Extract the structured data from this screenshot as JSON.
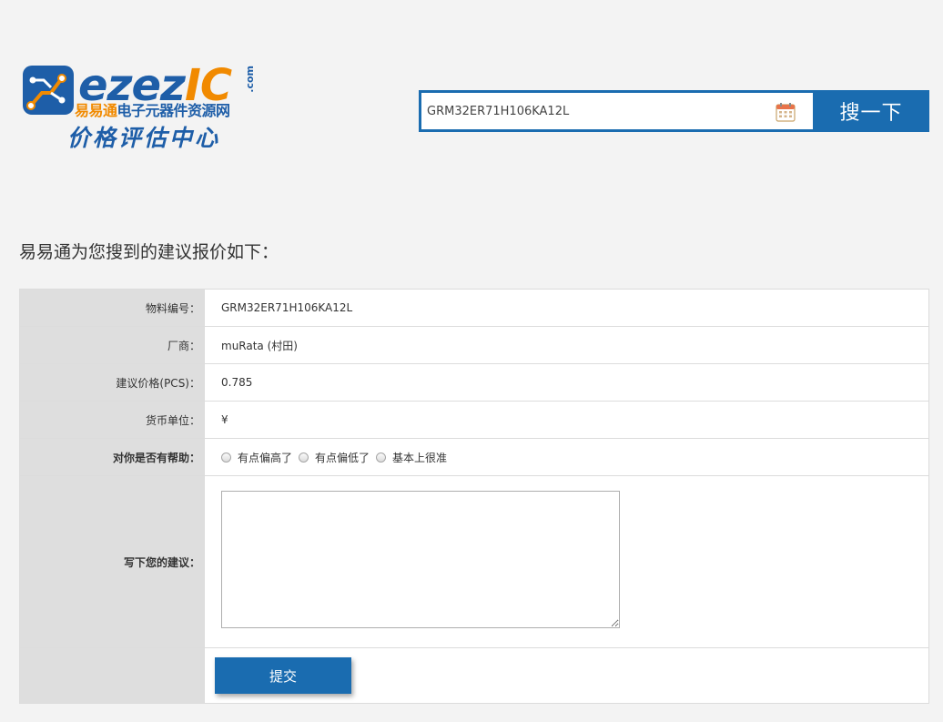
{
  "logo": {
    "brand_part1": "ezez",
    "brand_part2": "IC",
    "brand_domain": ".com",
    "tagline_part1": "易易通",
    "tagline_part2": "电子元器件资源网",
    "subtitle": "价格评估中心"
  },
  "search": {
    "value": "GRM32ER71H106KA12L",
    "button_label": "搜一下",
    "icon": "calendar-icon"
  },
  "intro_text": "易易通为您搜到的建议报价如下：",
  "table": {
    "part_number": {
      "label": "物料编号：",
      "value": "GRM32ER71H106KA12L"
    },
    "manufacturer": {
      "label": "厂商：",
      "value": "muRata (村田)"
    },
    "price": {
      "label": "建议价格(PCS)：",
      "value": "0.785"
    },
    "currency": {
      "label": "货币单位：",
      "value": "¥"
    },
    "helpful": {
      "label": "对你是否有帮助：",
      "options": [
        "有点偏高了",
        "有点偏低了",
        "基本上很准"
      ]
    },
    "suggestion": {
      "label": "写下您的建议：",
      "value": ""
    },
    "submit_label": "提交"
  },
  "colors": {
    "accent": "#1a6cb0",
    "brand_orange": "#f18a00",
    "label_bg": "#dedede",
    "page_bg": "#f3f3f3"
  }
}
